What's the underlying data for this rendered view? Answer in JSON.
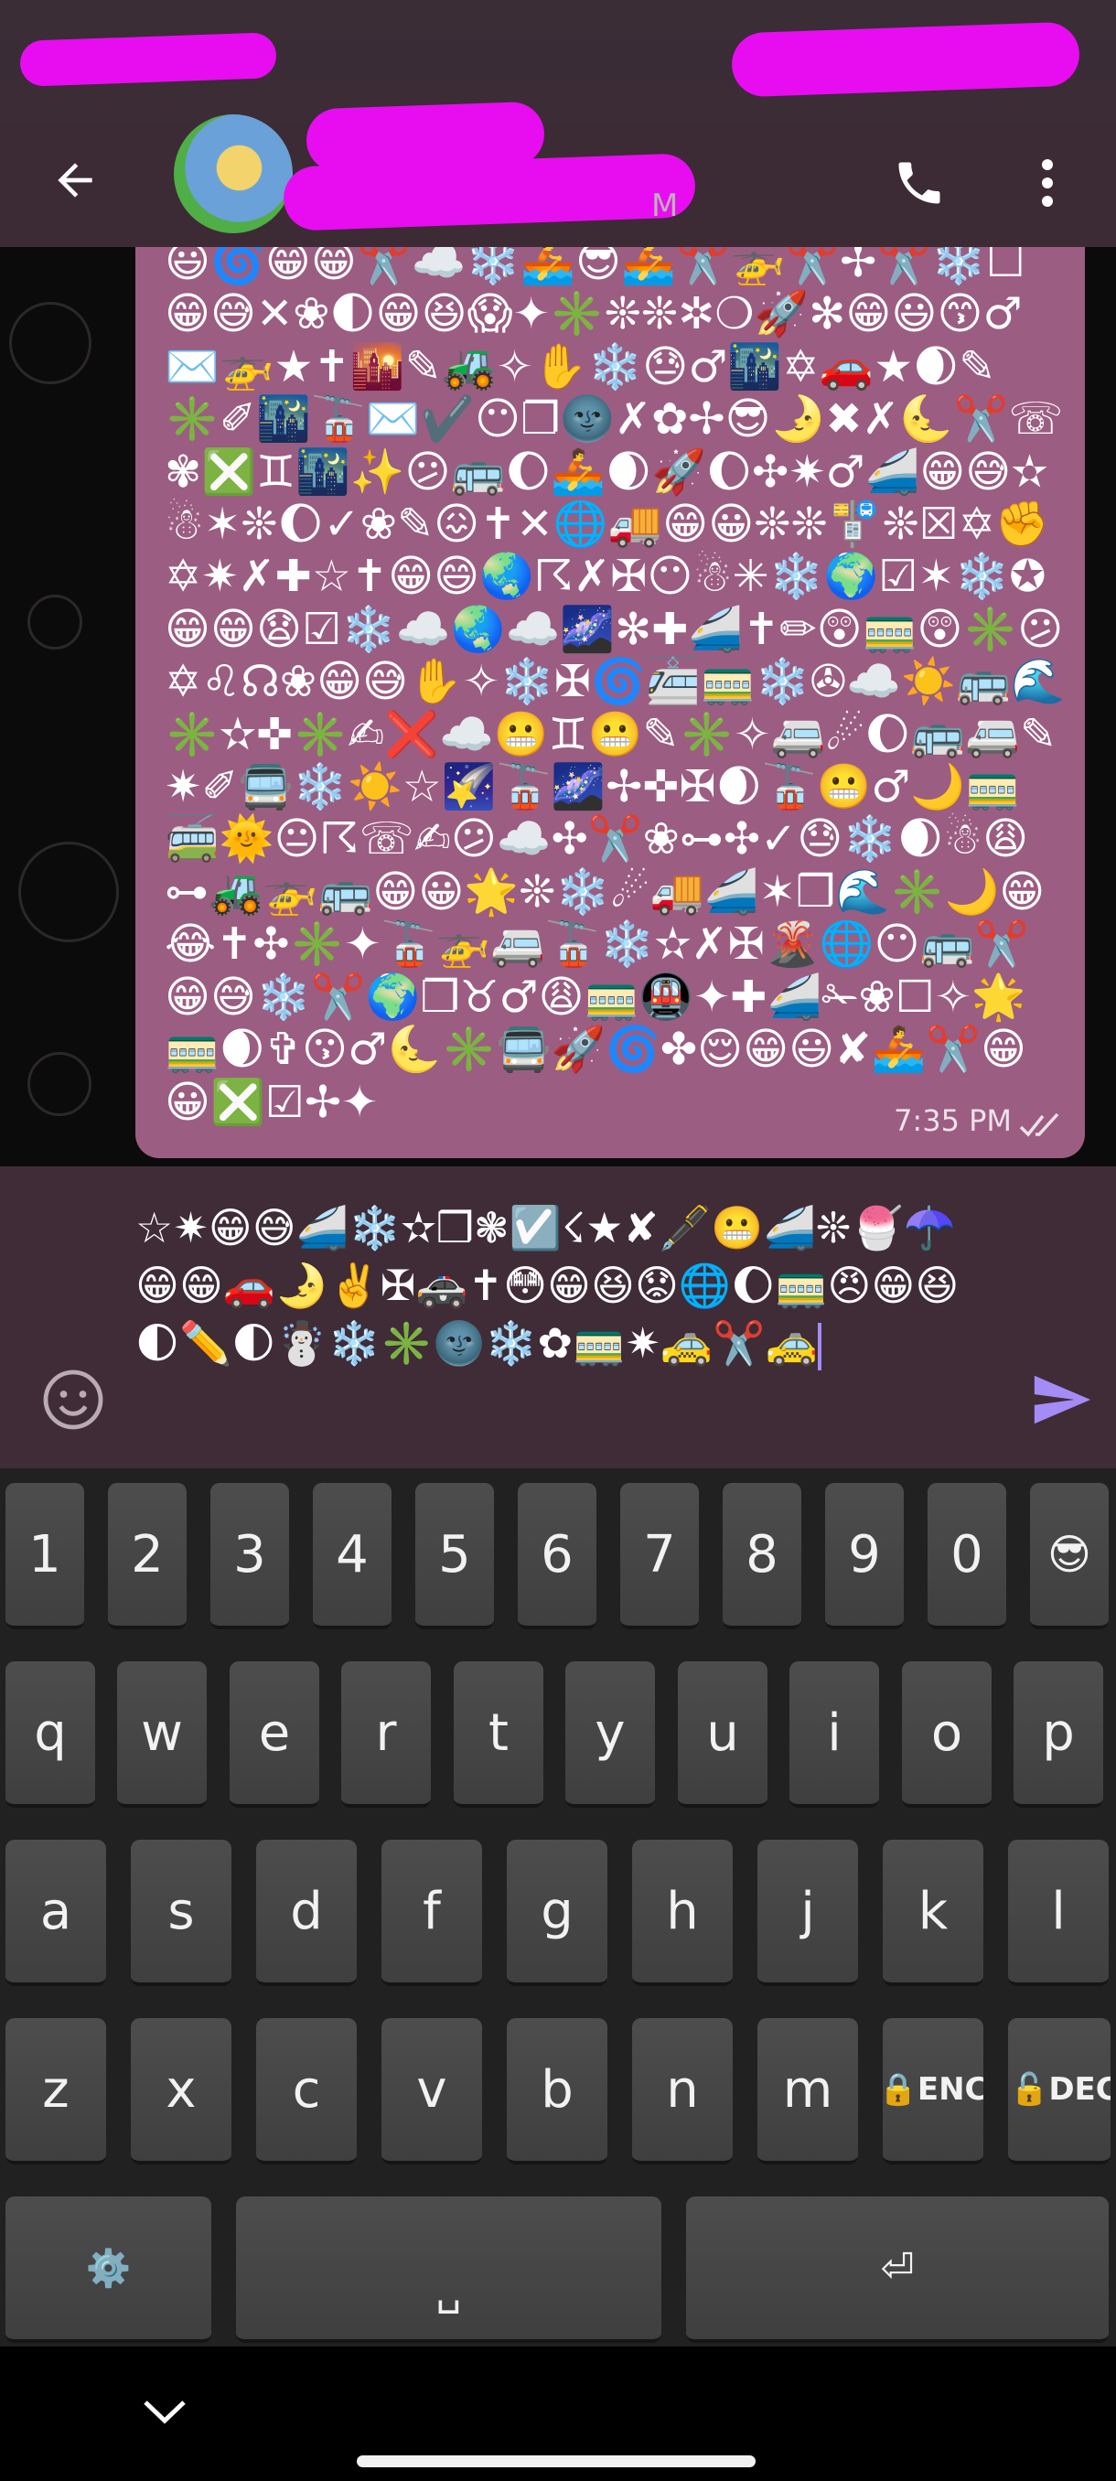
{
  "header": {
    "contact_subtitle": "M"
  },
  "message": {
    "text": "😃🌀😁😁✂️☁️❄️🚣😎🚣✂️🚁✂️✢✂️❄️☐😁😅✕❀🌓😁😆😱✦✳️❊❊✲❍🚀✻😁😃😙♂✉️🚁★✝🌇✎🚜✧✋❄️😓♂🌃✡🚗★🌒✎✳️✐🌃🚡✉️✔️😶❐🌚✗✿✢😎🌛✖✗🌜✂️☏✾❎♊🌃✨😕🚌🌔🚣🌒🚀🌔✣✷♂🚄😁😅✫☃✶❊🌔✓❀✎😖✝✕🌐🚚😁😀❊❊🚏❊☒✡✊✡✷✗✚☆✝😁😄🌏☈✗✠😶☃✳❄️🌍☑✶❄️✪😁😁😧☑❄️☁️🌏☁️🌌✻✚🚄✝✏😲🚃😲✳️😕✡♌☊❀😁😅✋✧❄️✠🌀🚈🚃❄️✇☁️☀️🚌🌊✳️✫✜✳️✍❌☁️😬♊😬✎✳️✧🚐☄🌔🚌🚐✎✷✐🚍❄️☀️☆🌠🚡🌌✢✜✠🌒🚡😬♂🌙🚃🚎🌞😐☈☏✍😕☁️✣✂️❀⊶✣✓😓❄️🌒☃😩⊶🚜🚁🚌😁😀🌟❊❄️☄🚚🚄✶❒🌊✳️🌙😁😂✝✣✳️✦🚡🚁🚐🚡❄️✫✗✠🌋🌐😶🚌✂️😁😅❄️✂️🌍❐♉♂😩🚃🚇✦✚🚄✁❀☐✧🌟🚃🌒✞😗♂🌜✳️🚍🚀🌀✤😌😁😃✘🚣✂️😁😀❎☑✢✦",
    "time": "7:35 PM"
  },
  "composer": {
    "text": "☆✷😁😅🚄❄️✫❒❃☑️☇★✘🖋️😬🚄❊🍧☂️😁😁🚗🌛✌️✠🚓✝😳😁😆😟🌐🌔🚃😠😁😆🌓✏️🌓☃️❄️✳️🌚❄️✿🚃✷🚕✂️🚕"
  },
  "keyboard": {
    "row1": [
      "1",
      "2",
      "3",
      "4",
      "5",
      "6",
      "7",
      "8",
      "9",
      "0",
      "😎"
    ],
    "row2": [
      "q",
      "w",
      "e",
      "r",
      "t",
      "y",
      "u",
      "i",
      "o",
      "p"
    ],
    "row3": [
      "a",
      "s",
      "d",
      "f",
      "g",
      "h",
      "j",
      "k",
      "l"
    ],
    "row4": [
      "z",
      "x",
      "c",
      "v",
      "b",
      "n",
      "m",
      "🔒ENC",
      "🔓DEC"
    ],
    "row5": [
      "⚙️",
      "␣",
      "⏎"
    ]
  },
  "colors": {
    "header_bg": "#3c2b34",
    "bubble_bg": "#9c5d82",
    "composer_bg": "#3f2c37",
    "keyboard_bg": "#212121",
    "key_bg": "#464646",
    "send_accent": "#a48cf6",
    "redaction": "#e70df0"
  },
  "icons": {
    "back": "arrow-left-icon",
    "call": "phone-icon",
    "menu": "more-vertical-icon",
    "emoji": "smiley-icon",
    "send": "send-icon",
    "read_receipt": "double-check-icon",
    "nav_down": "chevron-down-icon"
  }
}
